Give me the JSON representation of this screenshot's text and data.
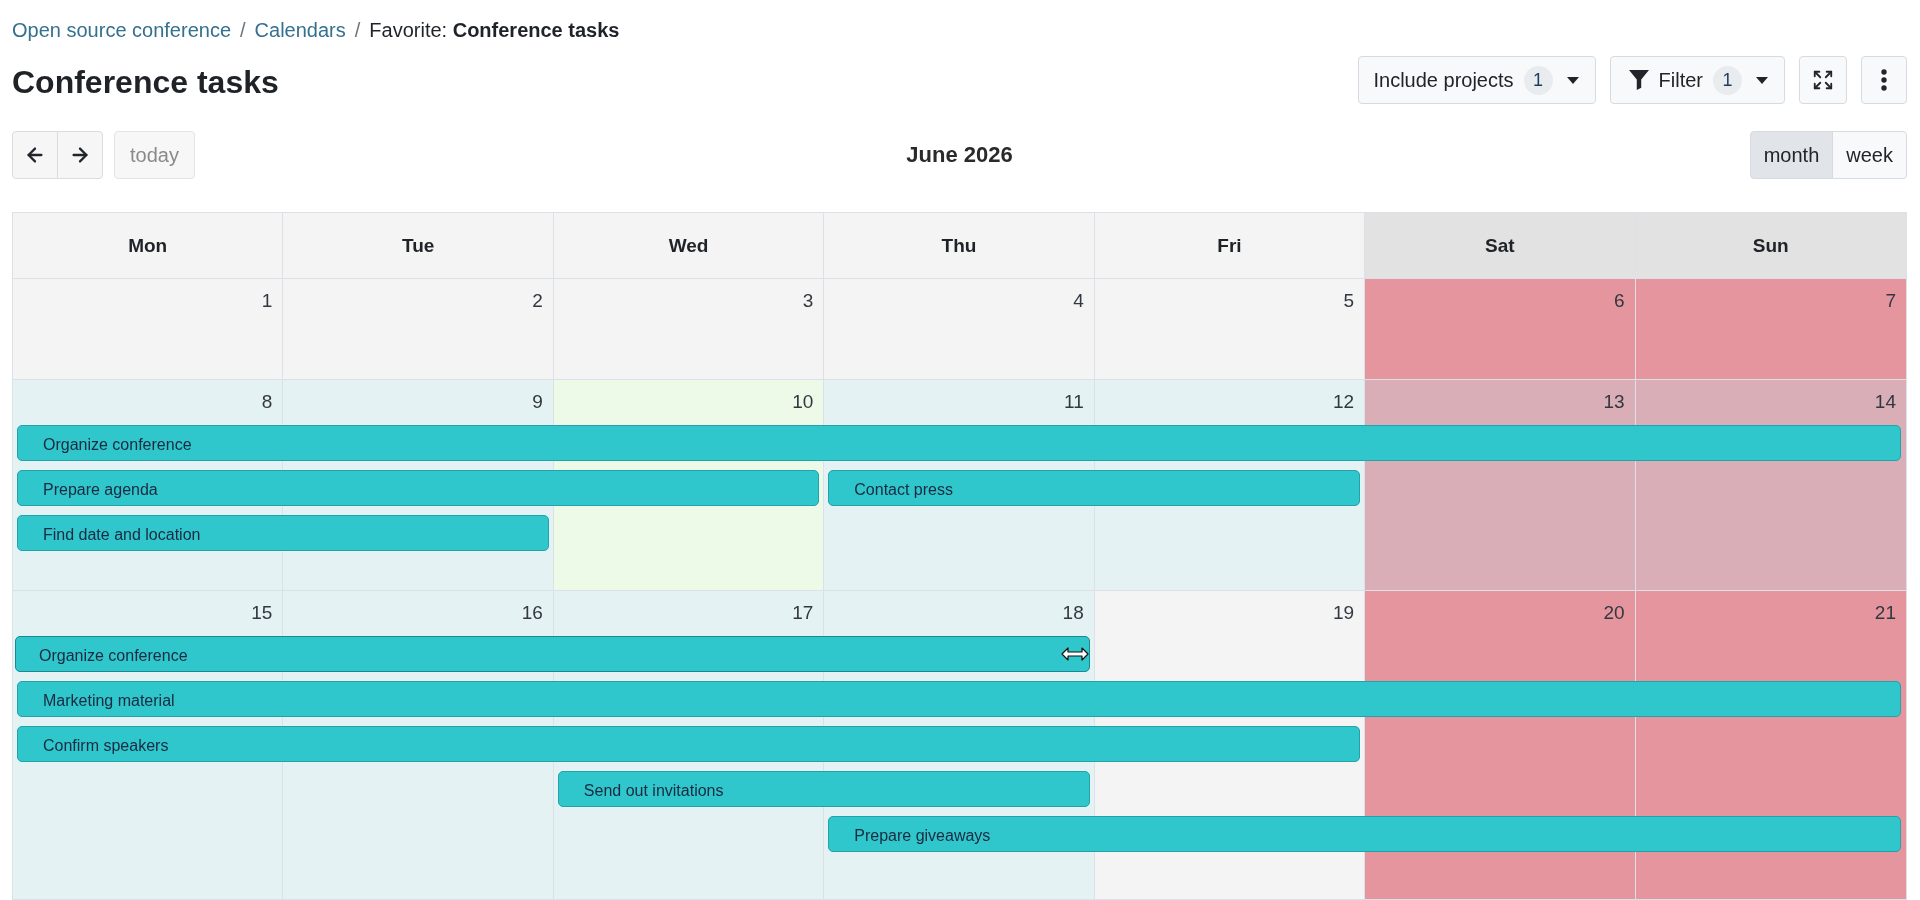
{
  "breadcrumb": {
    "separator": "/",
    "items": [
      {
        "label": "Open source conference",
        "link": true
      },
      {
        "label": "Calendars",
        "link": true
      },
      {
        "label": "Favorite: **Conference tasks**",
        "link": false
      }
    ]
  },
  "title": "Conference tasks",
  "toolbar": [
    {
      "kind": "select",
      "label": "Include projects",
      "badge": "1"
    },
    {
      "kind": "filter",
      "label": "Filter",
      "badge": "1"
    },
    {
      "kind": "fullscreen"
    },
    {
      "kind": "more"
    }
  ],
  "navigation": {
    "today": {
      "label": "today",
      "disabled": true
    }
  },
  "calendar_title": "June 2026",
  "views": [
    {
      "label": "month",
      "selected": true
    },
    {
      "label": "week",
      "selected": false
    }
  ],
  "calendar": {
    "weekdays": [
      {
        "label": "Mon",
        "weekend": false
      },
      {
        "label": "Tue",
        "weekend": false
      },
      {
        "label": "Wed",
        "weekend": false
      },
      {
        "label": "Thu",
        "weekend": false
      },
      {
        "label": "Fri",
        "weekend": false
      },
      {
        "label": "Sat",
        "weekend": true
      },
      {
        "label": "Sun",
        "weekend": true
      }
    ],
    "weeks": [
      {
        "days": [
          {
            "number": "1",
            "kind": "weekday",
            "highlighted": false
          },
          {
            "number": "2",
            "kind": "weekday",
            "highlighted": false
          },
          {
            "number": "3",
            "kind": "weekday",
            "highlighted": false
          },
          {
            "number": "4",
            "kind": "weekday",
            "highlighted": false
          },
          {
            "number": "5",
            "kind": "weekday",
            "highlighted": false
          },
          {
            "number": "6",
            "kind": "weekend",
            "highlighted": false
          },
          {
            "number": "7",
            "kind": "weekend",
            "highlighted": false
          }
        ]
      },
      {
        "days": [
          {
            "number": "8",
            "kind": "weekday",
            "highlighted": true
          },
          {
            "number": "9",
            "kind": "weekday",
            "highlighted": true
          },
          {
            "number": "10",
            "kind": "today",
            "highlighted": true
          },
          {
            "number": "11",
            "kind": "weekday",
            "highlighted": true
          },
          {
            "number": "12",
            "kind": "weekday",
            "highlighted": true
          },
          {
            "number": "13",
            "kind": "weekend",
            "highlighted": true
          },
          {
            "number": "14",
            "kind": "weekend",
            "highlighted": true
          }
        ],
        "lanes": [
          [
            {
              "kind": "start",
              "title": "Organize conference",
              "resizing": false
            },
            {
              "kind": "continue"
            },
            {
              "kind": "continue"
            },
            {
              "kind": "continue"
            },
            {
              "kind": "continue"
            },
            {
              "kind": "continue"
            },
            {
              "kind": "continue"
            }
          ],
          [
            {
              "kind": "start",
              "title": "Prepare agenda",
              "resizing": false
            },
            {
              "kind": "continue"
            },
            {
              "kind": "continue"
            },
            {
              "kind": "start",
              "title": "Contact press",
              "resizing": false
            },
            {
              "kind": "continue"
            },
            {
              "kind": "empty"
            },
            {
              "kind": "empty"
            }
          ],
          [
            {
              "kind": "start",
              "title": "Find date and location",
              "resizing": false
            },
            {
              "kind": "continue"
            },
            {
              "kind": "empty"
            },
            {
              "kind": "empty"
            },
            {
              "kind": "empty"
            },
            {
              "kind": "empty"
            },
            {
              "kind": "empty"
            }
          ]
        ]
      },
      {
        "days": [
          {
            "number": "15",
            "kind": "weekday",
            "highlighted": true
          },
          {
            "number": "16",
            "kind": "weekday",
            "highlighted": true
          },
          {
            "number": "17",
            "kind": "weekday",
            "highlighted": true
          },
          {
            "number": "18",
            "kind": "weekday",
            "highlighted": true
          },
          {
            "number": "19",
            "kind": "weekday",
            "highlighted": false
          },
          {
            "number": "20",
            "kind": "weekend",
            "highlighted": false
          },
          {
            "number": "21",
            "kind": "weekend",
            "highlighted": false
          }
        ],
        "lanes": [
          [
            {
              "kind": "start",
              "title": "Organize conference",
              "resizing": true
            },
            {
              "kind": "continue"
            },
            {
              "kind": "continue"
            },
            {
              "kind": "continue"
            },
            {
              "kind": "empty"
            },
            {
              "kind": "empty"
            },
            {
              "kind": "empty"
            }
          ],
          [
            {
              "kind": "start",
              "title": "Marketing material",
              "resizing": false
            },
            {
              "kind": "continue"
            },
            {
              "kind": "continue"
            },
            {
              "kind": "continue"
            },
            {
              "kind": "continue"
            },
            {
              "kind": "continue"
            },
            {
              "kind": "continue"
            }
          ],
          [
            {
              "kind": "start",
              "title": "Confirm speakers",
              "resizing": false
            },
            {
              "kind": "continue"
            },
            {
              "kind": "continue"
            },
            {
              "kind": "continue"
            },
            {
              "kind": "continue"
            },
            {
              "kind": "empty"
            },
            {
              "kind": "empty"
            }
          ],
          [
            {
              "kind": "empty"
            },
            {
              "kind": "empty"
            },
            {
              "kind": "start",
              "title": "Send out invitations",
              "resizing": false
            },
            {
              "kind": "continue"
            },
            {
              "kind": "empty"
            },
            {
              "kind": "empty"
            },
            {
              "kind": "empty"
            }
          ],
          [
            {
              "kind": "empty"
            },
            {
              "kind": "empty"
            },
            {
              "kind": "empty"
            },
            {
              "kind": "start",
              "title": "Prepare giveaways",
              "resizing": false
            },
            {
              "kind": "continue"
            },
            {
              "kind": "continue"
            },
            {
              "kind": "continue"
            }
          ]
        ]
      }
    ]
  }
}
